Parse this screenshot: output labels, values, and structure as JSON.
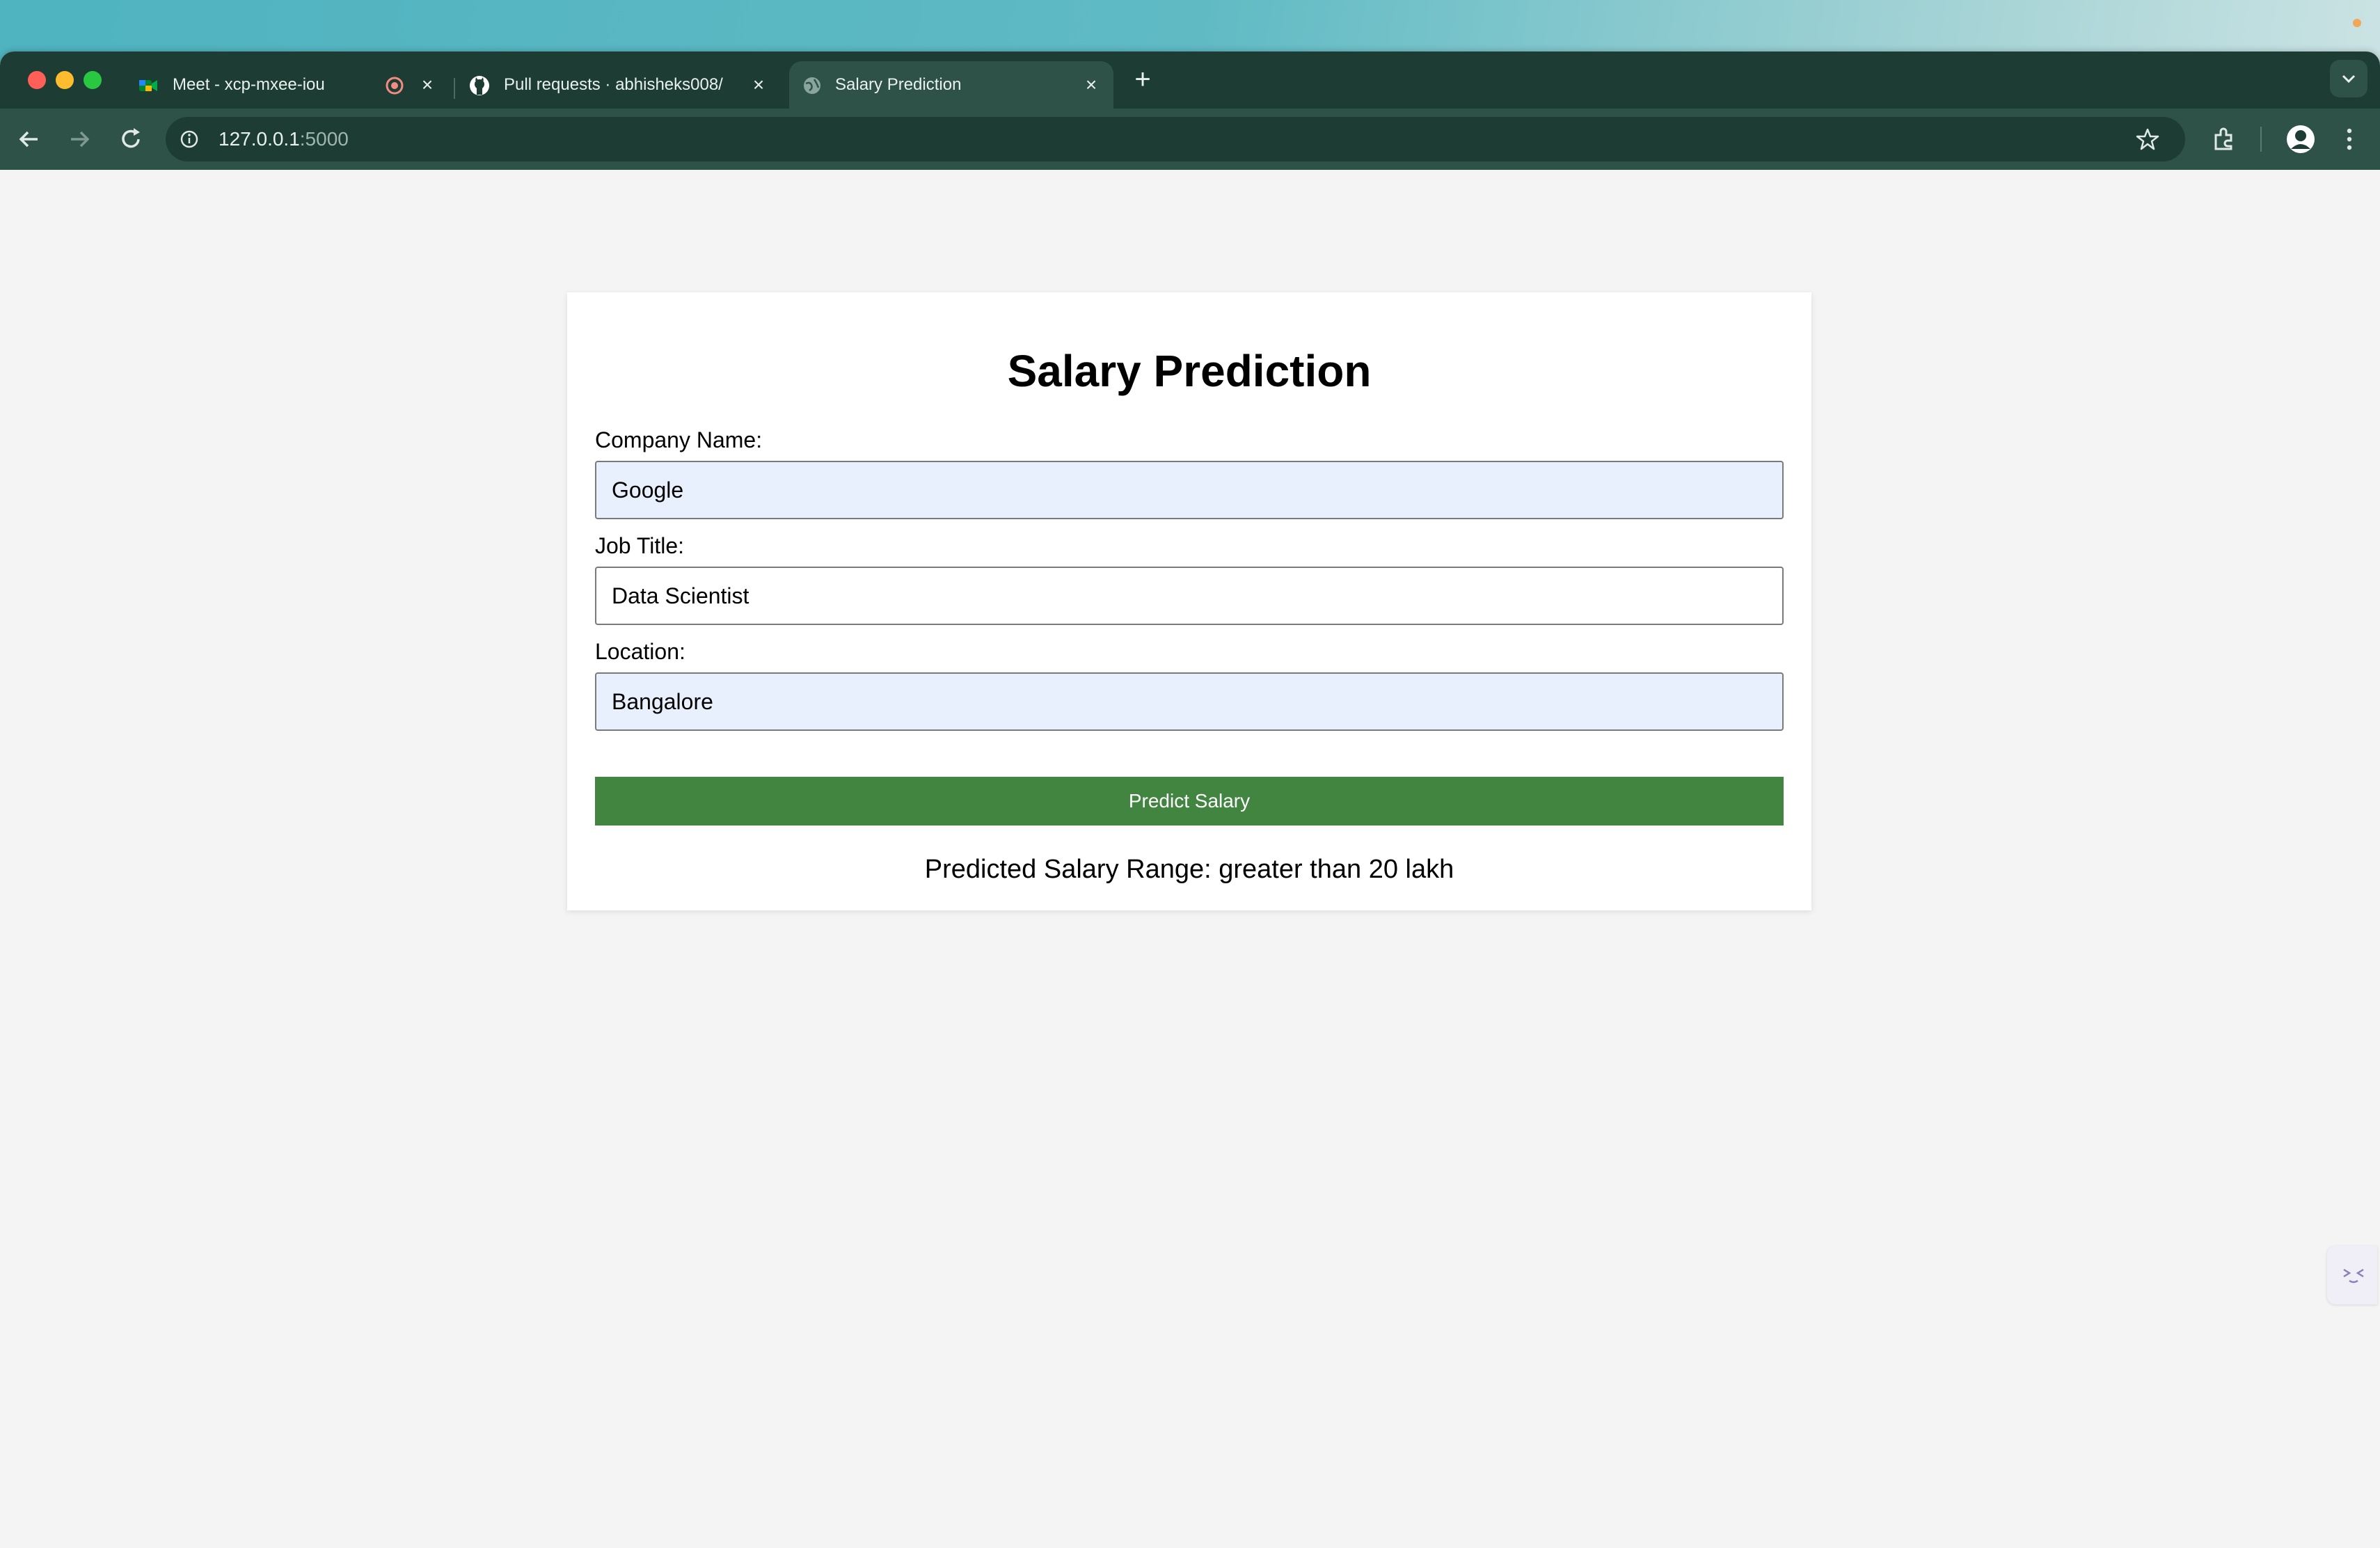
{
  "browser": {
    "tabs": [
      {
        "title": "Meet - xcp-mxee-iou",
        "icon": "google-meet-icon",
        "recording": true
      },
      {
        "title": "Pull requests · abhisheks008/",
        "icon": "github-icon"
      },
      {
        "title": "Salary Prediction",
        "icon": "globe-icon",
        "active": true
      }
    ],
    "address": {
      "host": "127.0.0.1",
      "port": ":5000"
    },
    "colors": {
      "tabbar": "#1d3c33",
      "toolbar": "#2e5247"
    }
  },
  "page": {
    "title": "Salary Prediction",
    "fields": [
      {
        "label": "Company Name:",
        "value": "Google"
      },
      {
        "label": "Job Title:",
        "value": "Data Scientist"
      },
      {
        "label": "Location:",
        "value": "Bangalore"
      }
    ],
    "button_label": "Predict Salary",
    "result": "Predicted Salary Range: greater than 20 lakh",
    "colors": {
      "button": "#418541",
      "autofill": "#e8f0fe"
    }
  }
}
